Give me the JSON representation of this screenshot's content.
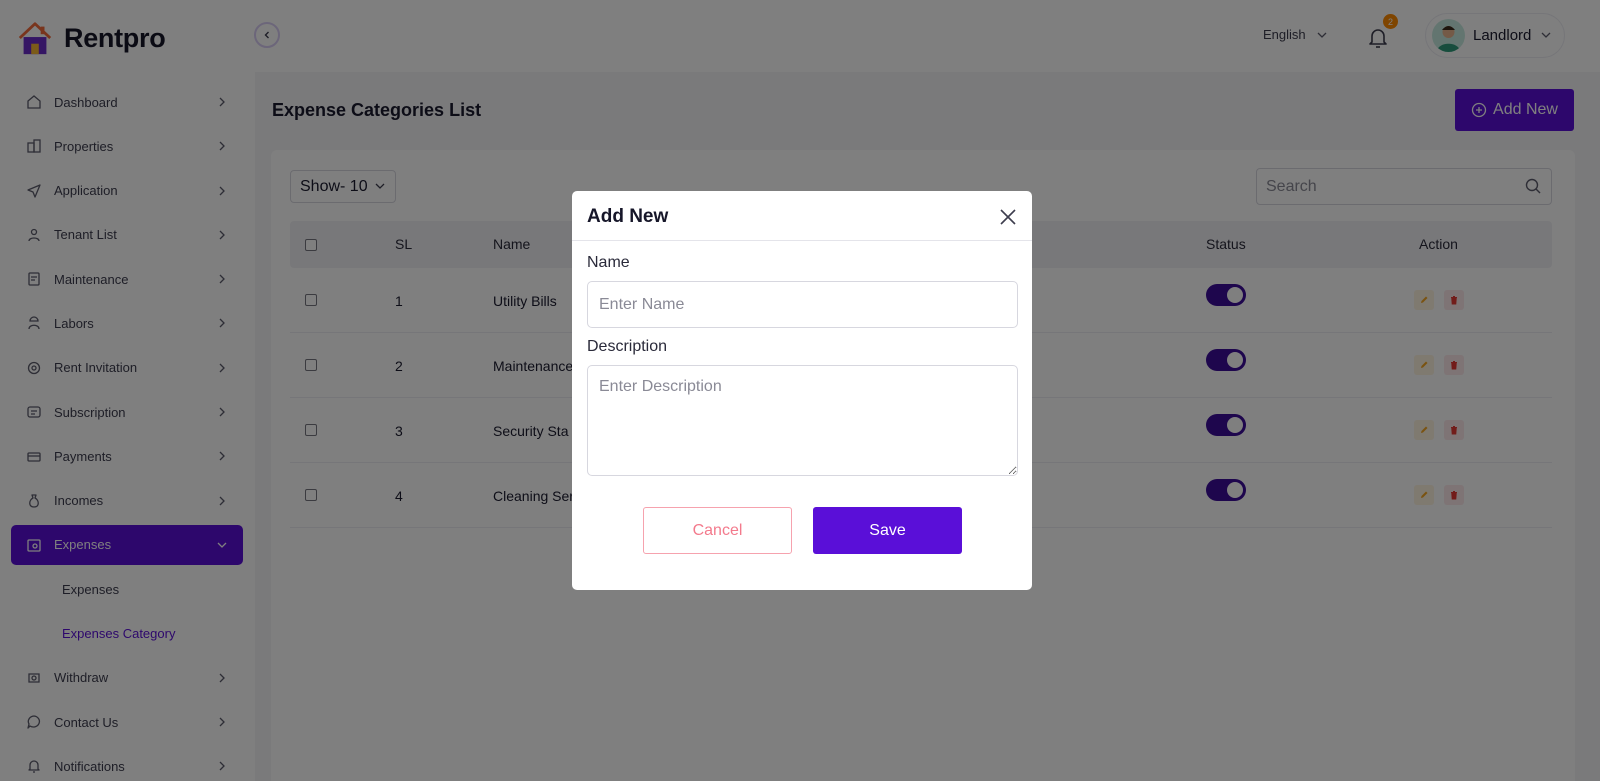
{
  "brand": {
    "name": "Rentpro"
  },
  "sidebar": {
    "items": [
      {
        "label": "Dashboard",
        "icon": "home-icon"
      },
      {
        "label": "Properties",
        "icon": "building-icon"
      },
      {
        "label": "Application",
        "icon": "send-icon"
      },
      {
        "label": "Tenant List",
        "icon": "users-icon"
      },
      {
        "label": "Maintenance",
        "icon": "clipboard-icon"
      },
      {
        "label": "Labors",
        "icon": "worker-icon"
      },
      {
        "label": "Rent Invitation",
        "icon": "invitation-icon"
      },
      {
        "label": "Subscription",
        "icon": "subscription-icon"
      },
      {
        "label": "Payments",
        "icon": "payments-icon"
      },
      {
        "label": "Incomes",
        "icon": "money-bag-icon"
      },
      {
        "label": "Expenses",
        "icon": "expenses-icon",
        "active": true
      },
      {
        "label": "Withdraw",
        "icon": "withdraw-icon"
      },
      {
        "label": "Contact Us",
        "icon": "chat-icon"
      },
      {
        "label": "Notifications",
        "icon": "bell-icon"
      }
    ],
    "sub_items": [
      {
        "label": "Expenses"
      },
      {
        "label": "Expenses Category",
        "active": true
      }
    ]
  },
  "topbar": {
    "language": "English",
    "notification_count": "2",
    "user_name": "Landlord"
  },
  "page": {
    "title": "Expense Categories List",
    "add_new_label": "Add New",
    "show_label": "Show- 10",
    "search_placeholder": "Search"
  },
  "table": {
    "headers": {
      "sl": "SL",
      "name": "Name",
      "status": "Status",
      "action": "Action"
    },
    "rows": [
      {
        "sl": "1",
        "name": "Utility Bills",
        "status_on": true
      },
      {
        "sl": "2",
        "name": "Maintenance",
        "status_on": true
      },
      {
        "sl": "3",
        "name": "Security Sta",
        "status_on": true
      },
      {
        "sl": "4",
        "name": "Cleaning Ser",
        "status_on": true
      }
    ]
  },
  "modal": {
    "title": "Add New",
    "name_label": "Name",
    "name_placeholder": "Enter Name",
    "description_label": "Description",
    "description_placeholder": "Enter Description",
    "cancel_label": "Cancel",
    "save_label": "Save"
  },
  "colors": {
    "primary": "#5a0fd8",
    "toggle_on": "#3d0d9a",
    "badge": "#ff8a00",
    "cancel": "#f37a8c"
  }
}
